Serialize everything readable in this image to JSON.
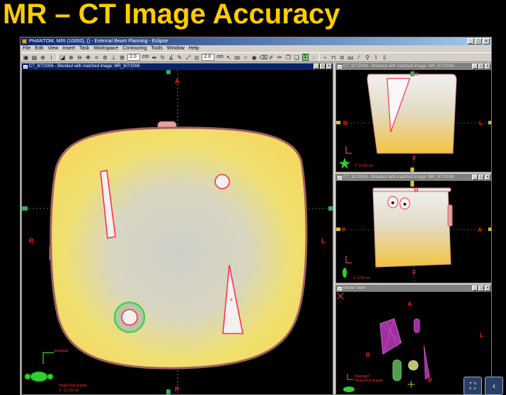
{
  "slide": {
    "title": "MR – CT Image Accuracy"
  },
  "window": {
    "title": "PHANTOM, MRI (10000), () - External Beam Planning - Eclipse",
    "buttons": [
      "_",
      "□",
      "×"
    ]
  },
  "menu": [
    "File",
    "Edit",
    "View",
    "Insert",
    "Task",
    "Workspace",
    "Contouring",
    "Tools",
    "Window",
    "Help"
  ],
  "toolbar": {
    "field1_value": "2.0",
    "field1_unit": "cm",
    "field2_value": "2.0",
    "field2_unit": "cm",
    "green_value": "1"
  },
  "panes": {
    "main": {
      "title": "CT_9/7/2006 - Blended with matched image: MR_9/7/2006",
      "labels": {
        "top": "A",
        "bottom": "P",
        "left": "R",
        "right": "L"
      },
      "info_standard": "Standard",
      "info_orientation": "Head First-Supine",
      "info_coord": "Z: -17.18 cm"
    },
    "coronal": {
      "title": "CT_9/7/2006 - Blended with matched image: MR_9/7/2006",
      "labels": {
        "top": "H",
        "bottom": "F",
        "left": "R",
        "right": "L"
      },
      "info_coord": "Y: 10.42 cm"
    },
    "sagittal": {
      "title": "CT_9/7/2006 - Blended with matched image: MR_9/7/2006",
      "labels": {
        "top": "H",
        "bottom": "F",
        "left": "P",
        "right": "A"
      },
      "info_coord": "X: 0.93 cm"
    },
    "model": {
      "title": "Model View",
      "labels": {
        "top": "A",
        "left": "R",
        "right": "L",
        "bottom": "P"
      },
      "info_standard": "Standard",
      "info_orientation": "Head First-Supine"
    }
  },
  "colors": {
    "slide_title": "#ffcc00",
    "phantom_fill": "#f0e070",
    "contour": "#ff3050",
    "orientation_label": "#ff2020"
  },
  "nav": {
    "fit_icon": "fit-screen-icon",
    "prev_icon": "chevron-left-icon",
    "fit_glyph": "⛶",
    "prev_glyph": "‹"
  }
}
